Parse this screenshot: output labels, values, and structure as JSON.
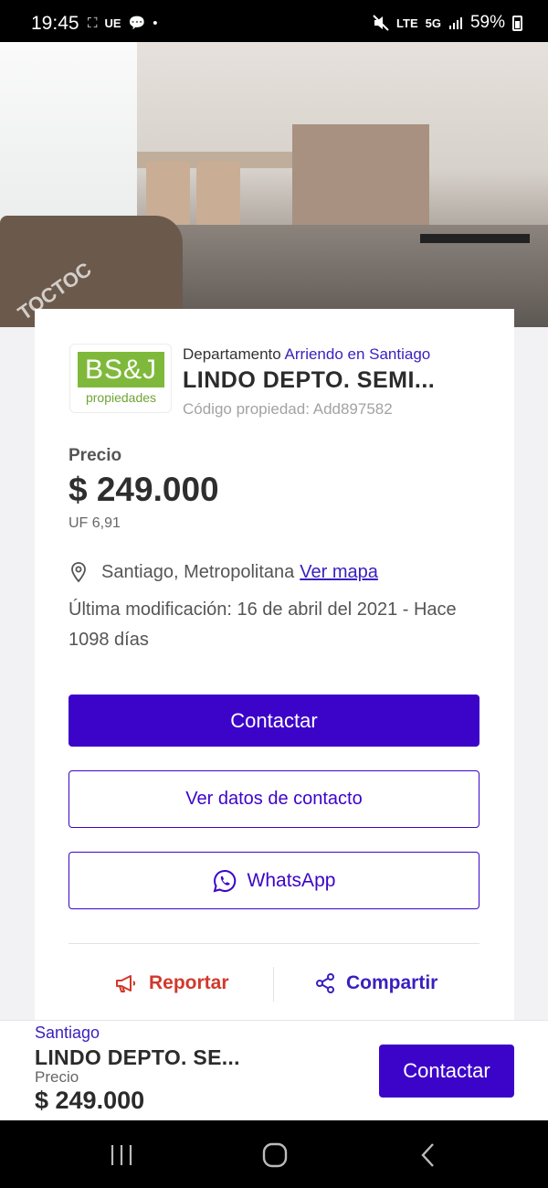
{
  "status_bar": {
    "time": "19:45",
    "left_glyphs": [
      "⛶",
      "UE",
      "💬",
      "•"
    ],
    "battery": "59%",
    "network": "5G",
    "volte": "LTE"
  },
  "photo": {
    "watermark": "TOCTOC"
  },
  "listing": {
    "logo_main": "BS&J",
    "logo_sub": "propiedades",
    "type_prefix": "Departamento",
    "type_accent": "Arriendo en Santiago",
    "title": "LINDO DEPTO. SEMI...",
    "code": "Código propiedad: Add897582",
    "price_label": "Precio",
    "price": "$ 249.000",
    "uf": "UF 6,91",
    "location": "Santiago, Metropolitana",
    "map_link": "Ver mapa",
    "modified": "Última modificación: 16 de abril del 2021 - Hace 1098 días"
  },
  "buttons": {
    "contact": "Contactar",
    "contact_data": "Ver datos de contacto",
    "whatsapp": "WhatsApp",
    "report": "Reportar",
    "share": "Compartir"
  },
  "bottom_bar": {
    "location": "Santiago",
    "title": "LINDO DEPTO. SE...",
    "price_label": "Precio",
    "price": "$ 249.000",
    "contact": "Contactar"
  },
  "colors": {
    "primary": "#3c04c9",
    "accent_text": "#3a1fbf",
    "report": "#d1392b",
    "logo_green": "#7fb93b"
  }
}
